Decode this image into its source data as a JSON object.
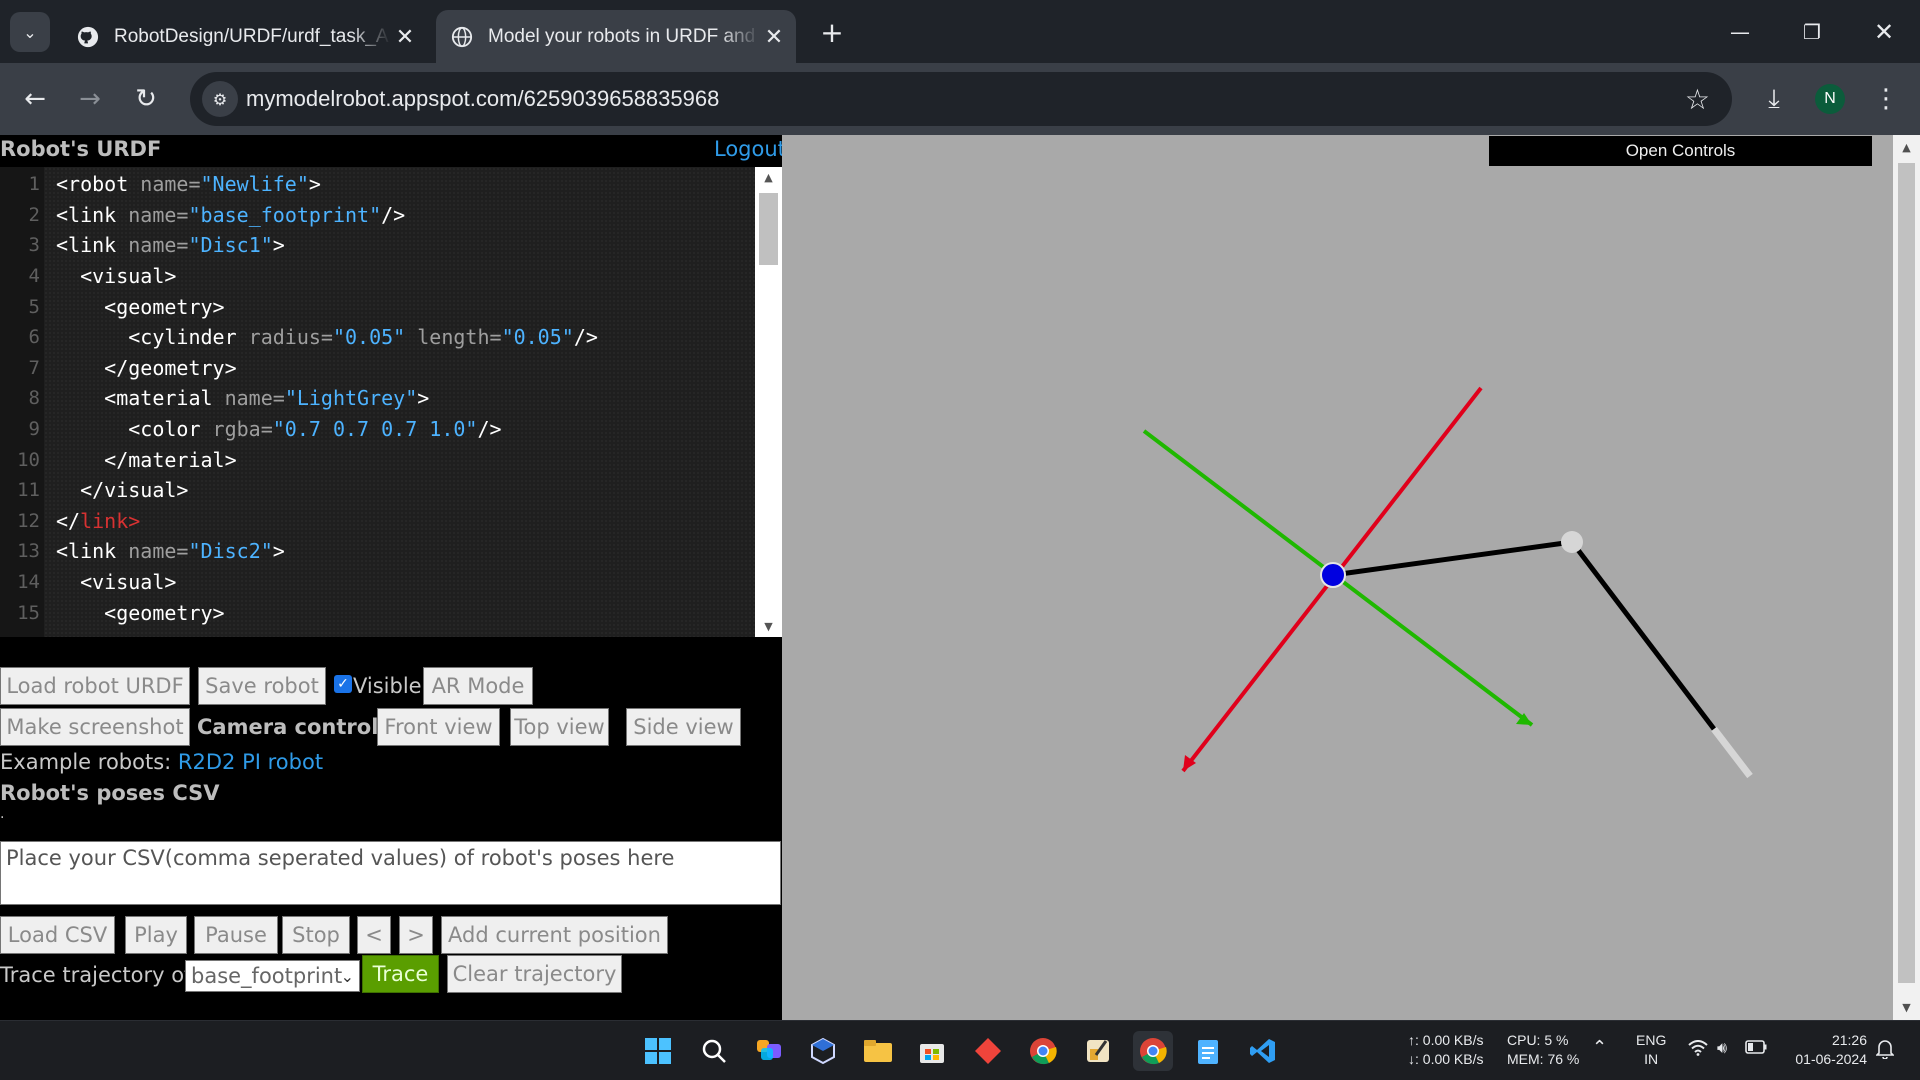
{
  "browser": {
    "tabs": [
      {
        "title": "RobotDesign/URDF/urdf_task_A",
        "active": false,
        "icon": "github-icon"
      },
      {
        "title": "Model your robots in URDF and",
        "active": true,
        "icon": "globe-icon"
      }
    ],
    "url": "mymodelrobot.appspot.com/6259039658835968",
    "profile_initial": "N"
  },
  "left_panel": {
    "urdf_title": "Robot's URDF",
    "logout": "Logout",
    "buttons": {
      "load_urdf": "Load robot URDF",
      "save_robot": "Save robot",
      "visible": "Visible",
      "ar_mode": "AR Mode",
      "make_screenshot": "Make screenshot",
      "camera_controls": "Camera controls:",
      "front_view": "Front view",
      "top_view": "Top view",
      "side_view": "Side view"
    },
    "examples_label": "Example robots:",
    "examples": [
      "R2D2",
      "PI robot"
    ],
    "poses_title": "Robot's poses CSV",
    "dot": ".",
    "csv_placeholder": "Place your CSV(comma seperated values) of robot's poses here",
    "playback": {
      "load_csv": "Load CSV",
      "play": "Play",
      "pause": "Pause",
      "stop": "Stop",
      "prev": "<",
      "next": ">",
      "add_position": "Add current position"
    },
    "trace_label": "Trace trajectory of:",
    "trace_select": "base_footprint",
    "trace_btn": "Trace",
    "clear_trajectory": "Clear trajectory"
  },
  "viewport": {
    "open_controls": "Open Controls",
    "colors": {
      "x_axis": "#e0001b",
      "y_axis": "#1fb800",
      "joint": "#0000e0",
      "link": "#000000",
      "end": "#d6d6d6"
    }
  },
  "taskbar": {
    "net_up": "↑: 0.00 KB/s",
    "net_down": "↓: 0.00 KB/s",
    "cpu": "CPU: 5 %",
    "mem": "MEM: 76 %",
    "lang_top": "ENG",
    "lang_bottom": "IN",
    "time": "21:26",
    "date": "01-06-2024"
  }
}
